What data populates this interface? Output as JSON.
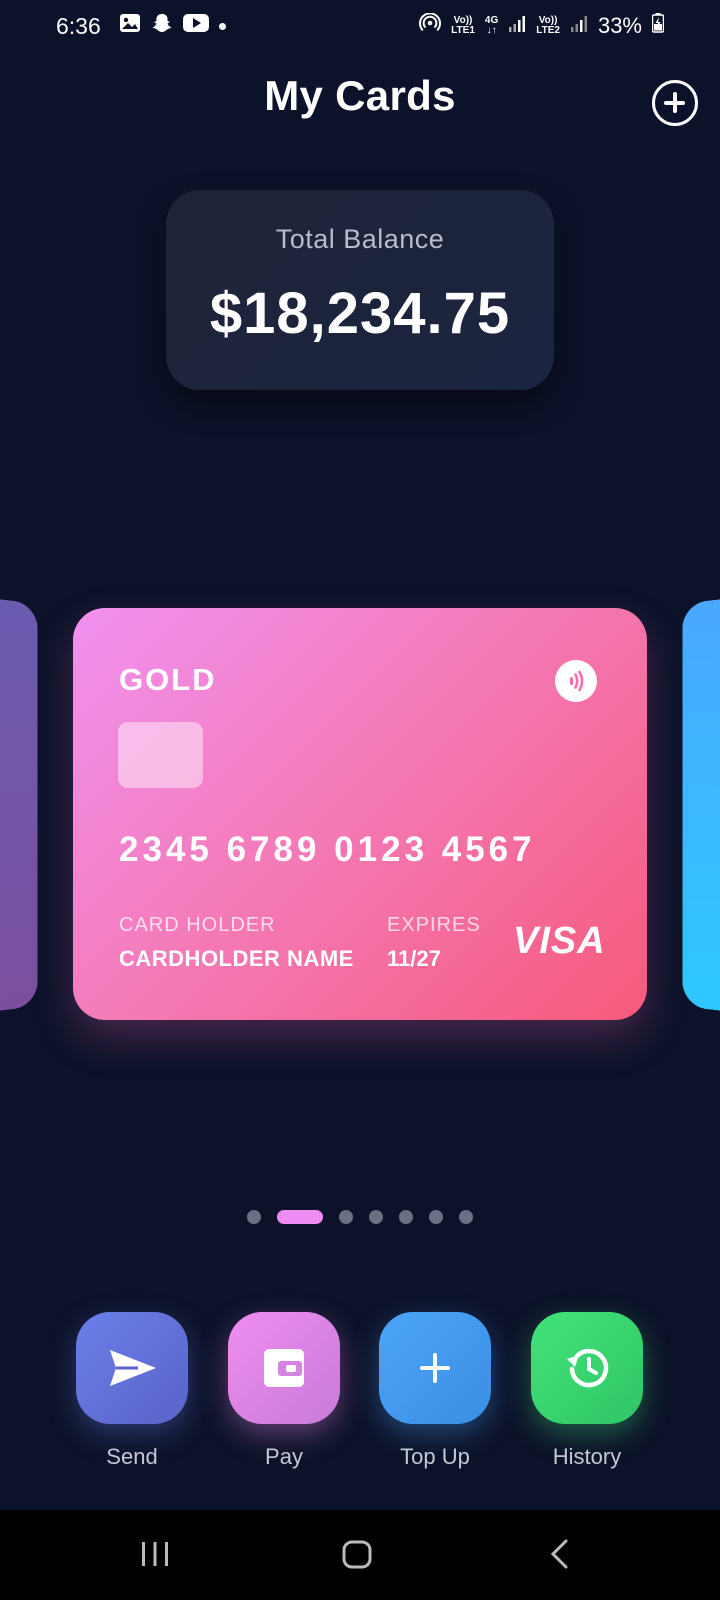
{
  "status_bar": {
    "time": "6:36",
    "net_lte1_top": "Vo))",
    "net_lte1_bottom": "LTE1",
    "net_4g": "4G",
    "net_lte2_top": "Vo))",
    "net_lte2_bottom": "LTE2",
    "battery": "33%"
  },
  "header": {
    "title": "My Cards"
  },
  "balance": {
    "label": "Total Balance",
    "value": "$18,234.75"
  },
  "card": {
    "tier": "GOLD",
    "number": "2345 6789 0123 4567",
    "holder_label": "CARD HOLDER",
    "holder_name": "CARDHOLDER NAME",
    "expires_label": "EXPIRES",
    "expires_value": "11/27",
    "brand": "VISA"
  },
  "pagination": {
    "total": 7,
    "active_index": 1
  },
  "actions": [
    {
      "label": "Send",
      "icon": "send-icon"
    },
    {
      "label": "Pay",
      "icon": "wallet-icon"
    },
    {
      "label": "Top Up",
      "icon": "plus-icon"
    },
    {
      "label": "History",
      "icon": "history-icon"
    }
  ],
  "colors": {
    "background": "#0c1229",
    "card_gradient_start": "#f191f2",
    "card_gradient_end": "#f65a7b",
    "dot_active": "#ee8cf3"
  }
}
